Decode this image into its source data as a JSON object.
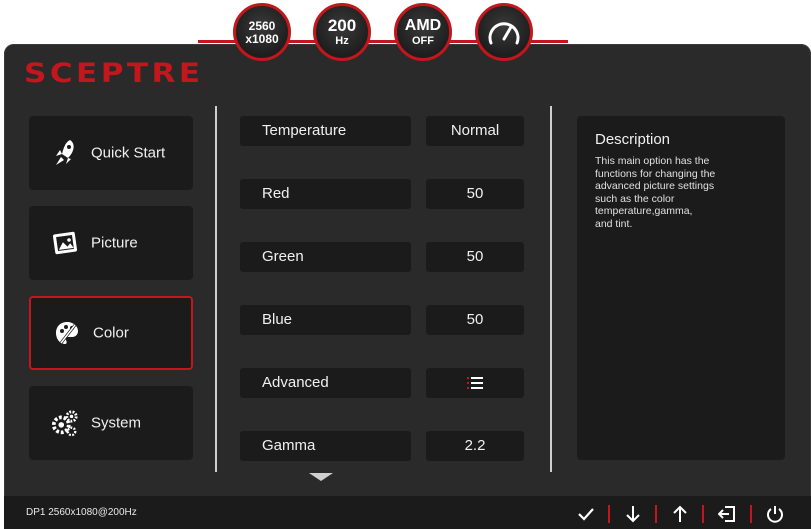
{
  "badges": {
    "resolution": {
      "line1": "2560",
      "line2": "x1080"
    },
    "refresh": {
      "line1": "200",
      "line2": "Hz"
    },
    "amd": {
      "line1": "AMD",
      "line2": "OFF"
    },
    "gauge_icon": "speedometer-icon"
  },
  "brand": {
    "logo": "SCEPTRE",
    "accent": "#c3161d"
  },
  "menu": [
    {
      "label": "Quick Start",
      "icon": "rocket-icon"
    },
    {
      "label": "Picture",
      "icon": "picture-icon"
    },
    {
      "label": "Color",
      "icon": "palette-icon",
      "active": true
    },
    {
      "label": "System",
      "icon": "gears-icon"
    }
  ],
  "settings": [
    {
      "label": "Temperature",
      "value": "Normal"
    },
    {
      "label": "Red",
      "value": "50"
    },
    {
      "label": "Green",
      "value": "50"
    },
    {
      "label": "Blue",
      "value": "50"
    },
    {
      "label": "Advanced",
      "value": "",
      "value_icon": "list-icon"
    },
    {
      "label": "Gamma",
      "value": "2.2"
    }
  ],
  "description": {
    "title": "Description",
    "text": "This main option has the\nfunctions for changing the\nadvanced picture settings\nsuch as the color\ntemperature,gamma,\nand tint."
  },
  "footer": {
    "status": "DP1 2560x1080@200Hz",
    "buttons": [
      "check-icon",
      "arrow-down-icon",
      "arrow-up-icon",
      "exit-icon",
      "power-icon"
    ]
  }
}
